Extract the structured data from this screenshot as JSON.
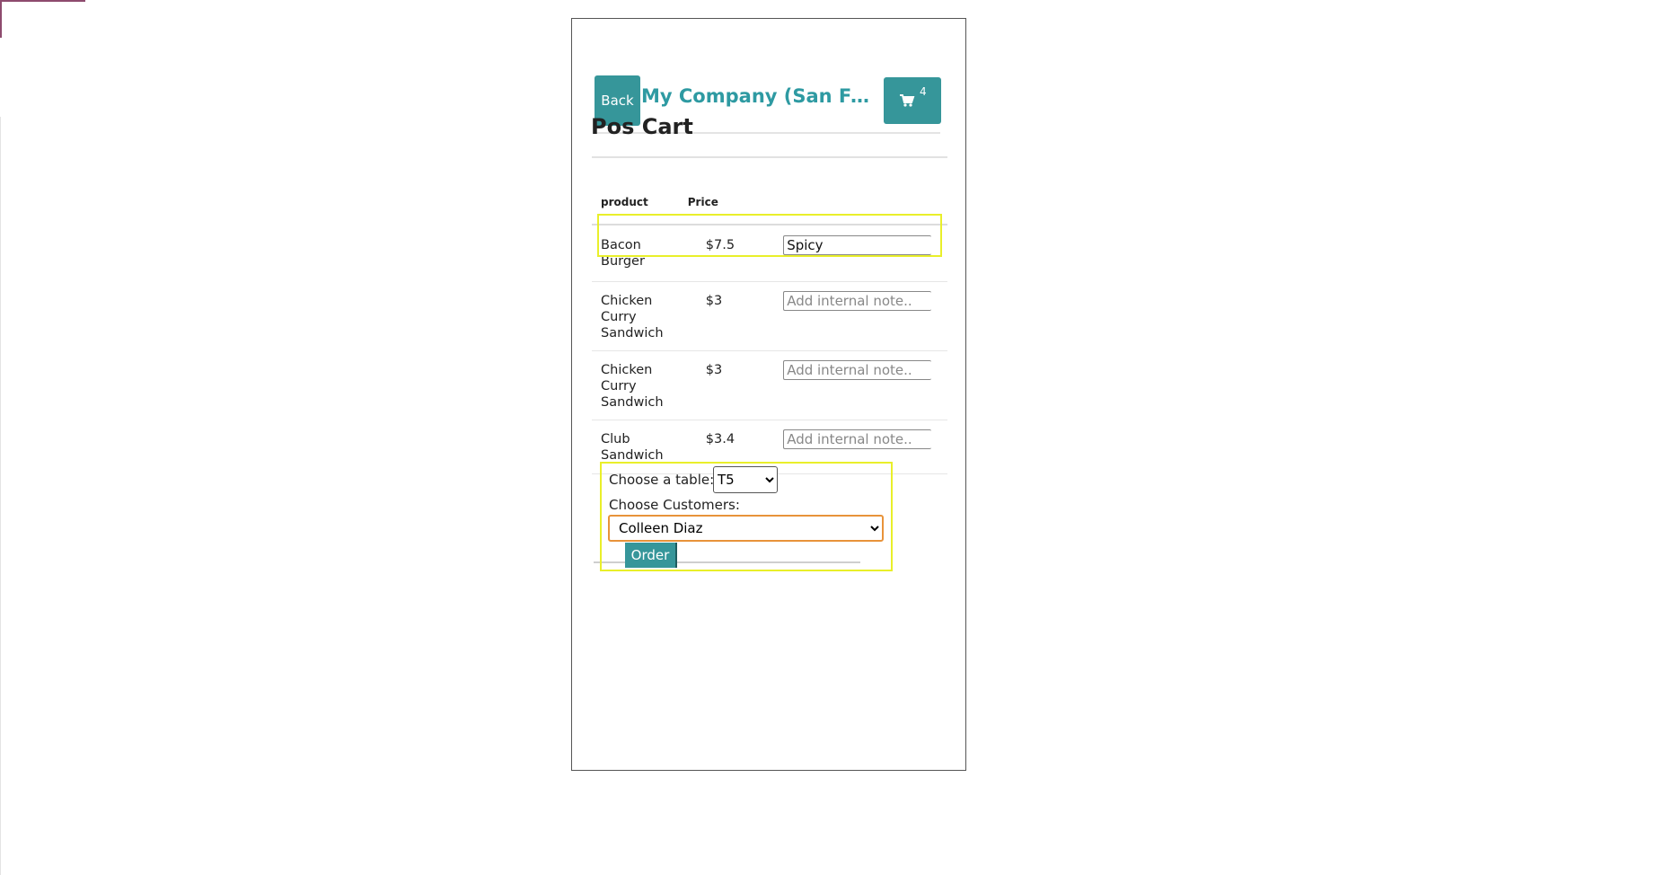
{
  "header": {
    "back_label": "Back",
    "company_name": "My Company (San Francisco)",
    "cart_count": "4"
  },
  "page": {
    "title": "Pos Cart"
  },
  "table": {
    "headers": [
      "product",
      "Price"
    ],
    "rows": [
      {
        "product": "Bacon Burger",
        "price": "$7.5",
        "note_value": "Spicy",
        "note_placeholder": "Add internal note.."
      },
      {
        "product": "Chicken Curry Sandwich",
        "price": "$3",
        "note_value": "",
        "note_placeholder": "Add internal note.."
      },
      {
        "product": "Chicken Curry Sandwich",
        "price": "$3",
        "note_value": "",
        "note_placeholder": "Add internal note.."
      },
      {
        "product": "Club Sandwich",
        "price": "$3.4",
        "note_value": "",
        "note_placeholder": "Add internal note.."
      }
    ]
  },
  "form": {
    "table_label": "Choose a table:",
    "table_selected": "T5",
    "customer_label": "Choose Customers:",
    "customer_selected": "Colleen Diaz",
    "order_label": "Order"
  },
  "icons": {
    "cart": "shopping-cart-icon"
  },
  "colors": {
    "accent": "#36969a",
    "company_title": "#2e9aa2",
    "highlight": "#e9ef2a",
    "focus": "#e8933a"
  }
}
